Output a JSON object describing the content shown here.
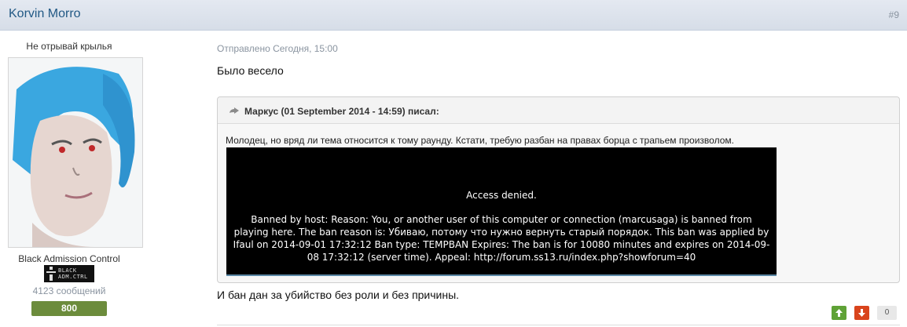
{
  "post": {
    "author": "Korvin Morro",
    "number": "#9",
    "meta": "Отправлено Сегодня, 15:00",
    "text_before": "Было весело",
    "text_after": "И бан дан за убийство без роли и без причины."
  },
  "user": {
    "title": "Не отрывай крылья",
    "group": "Black Admission Control",
    "group_icon_text": "BLACK ADM.CTRL",
    "post_count": "4123 сообщений",
    "reputation": "800",
    "reputation_color": "#6c8c3c"
  },
  "quote": {
    "citation": "Маркус (01 September 2014 - 14:59) писал:",
    "text": "Молодец, но вряд ли тема относится к тому раунду. Кстати, требую разбан на правах борца с трапьем произволом.",
    "image": {
      "title": "Access denied.",
      "body": "Banned by host:  Reason: You, or another user of this computer or connection (marcusaga) is banned from playing here. The ban reason is: Убиваю, потому что нужно вернуть старый порядок. This ban was applied by Ifaul on 2014-09-01 17:32:12  Ban type: TEMPBAN  Expires:  The ban is for 10080 minutes and expires on 2014-09-08 17:32:12 (server time).  Appeal: http://forum.ss13.ru/index.php?showforum=40"
    }
  },
  "rating": {
    "count": "0",
    "up_icon": "arrow-up-icon",
    "down_icon": "arrow-down-icon",
    "up_color": "#5fa236",
    "down_color": "#d9441c"
  }
}
